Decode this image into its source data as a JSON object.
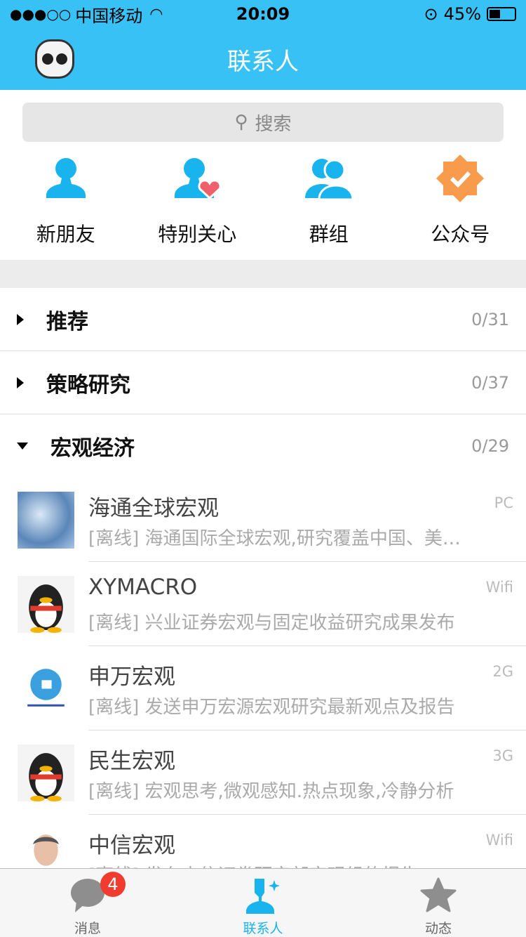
{
  "status": {
    "signal": "●●●○○",
    "carrier": "中国移动",
    "time": "20:09",
    "battery": "45%",
    "battery_level": 0.45
  },
  "header": {
    "title": "联系人"
  },
  "search": {
    "placeholder": "搜索"
  },
  "quick": [
    {
      "label": "新朋友",
      "icon": "person-icon"
    },
    {
      "label": "特别关心",
      "icon": "person-heart-icon"
    },
    {
      "label": "群组",
      "icon": "group-icon"
    },
    {
      "label": "公众号",
      "icon": "verified-badge-icon"
    }
  ],
  "groups": [
    {
      "name": "推荐",
      "count": "0/31",
      "expanded": false
    },
    {
      "name": "策略研究",
      "count": "0/37",
      "expanded": false
    },
    {
      "name": "宏观经济",
      "count": "0/29",
      "expanded": true
    }
  ],
  "contacts": [
    {
      "name": "海通全球宏观",
      "device": "PC",
      "preview": "[离线] 海通国际全球宏观,研究覆盖中国、美国、欧洲"
    },
    {
      "name": "XYMACRO",
      "device": "Wifi",
      "preview": "[离线] 兴业证券宏观与固定收益研究成果发布"
    },
    {
      "name": "申万宏观",
      "device": "2G",
      "preview": "[离线] 发送申万宏源宏观研究最新观点及报告"
    },
    {
      "name": "民生宏观",
      "device": "3G",
      "preview": "[离线] 宏观思考,微观感知.热点现象,冷静分析"
    },
    {
      "name": "中信宏观",
      "device": "Wifi",
      "preview": "[离线] 发布中信证券研究部宏观组的报告"
    }
  ],
  "tabs": [
    {
      "label": "消息",
      "badge": "4"
    },
    {
      "label": "联系人"
    },
    {
      "label": "动态"
    }
  ],
  "colors": {
    "brand": "#37c1f4",
    "accent": "#19b3ee",
    "badge": "#f03c2e",
    "official": "#f89b4c"
  }
}
